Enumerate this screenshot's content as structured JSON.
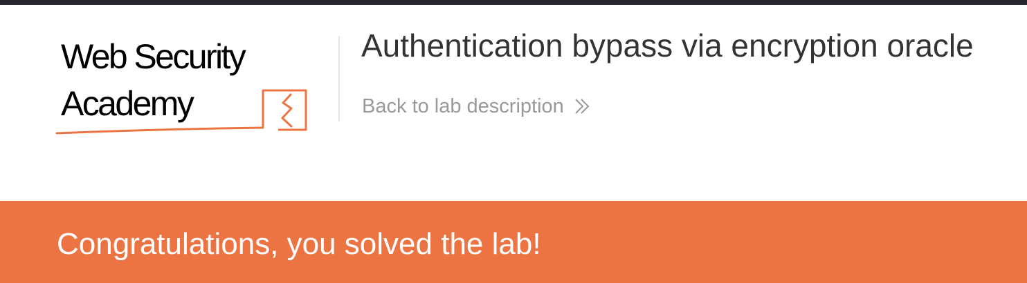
{
  "brand": {
    "line1": "Web Security",
    "line2": "Academy",
    "accent_color": "#ec7443"
  },
  "header": {
    "lab_title": "Authentication bypass via encryption oracle",
    "back_link_label": "Back to lab description",
    "back_link_icon": "double-chevron-right-icon"
  },
  "notification": {
    "message": "Congratulations, you solved the lab!",
    "background_color": "#ec7443"
  }
}
